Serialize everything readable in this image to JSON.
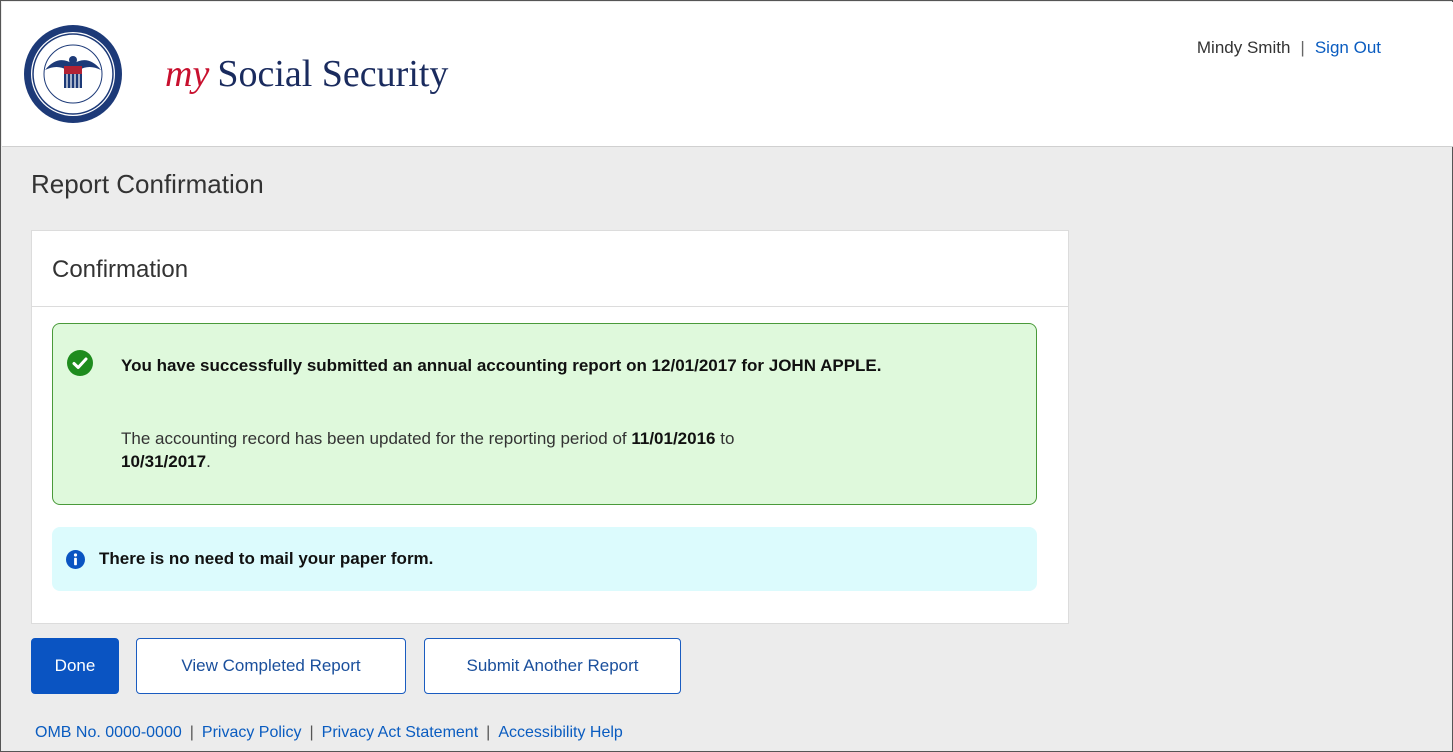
{
  "header": {
    "brand_prefix": "my",
    "brand_name": "Social Security",
    "user_name": "Mindy Smith",
    "separator": "|",
    "sign_out": "Sign Out"
  },
  "page": {
    "title": "Report Confirmation"
  },
  "card": {
    "title": "Confirmation",
    "success": {
      "title": "You have successfully submitted an annual accounting report on 12/01/2017 for JOHN APPLE.",
      "body_prefix": "The accounting record has been updated for the reporting period of ",
      "start_date": "11/01/2016",
      "body_middle": " to ",
      "end_date": "10/31/2017",
      "body_suffix": "."
    },
    "info": {
      "text": "There is no need to mail your paper form."
    }
  },
  "buttons": {
    "done": "Done",
    "view": "View Completed Report",
    "submit": "Submit Another Report"
  },
  "footer": {
    "links": [
      "OMB No. 0000-0000",
      "Privacy Policy",
      "Privacy Act Statement",
      "Accessibility Help"
    ]
  },
  "colors": {
    "brand_red": "#c8102e",
    "brand_navy": "#1a2b5e",
    "primary_blue": "#0a54c2",
    "success_bg": "#dff9dc",
    "info_bg": "#dcfbfd"
  }
}
